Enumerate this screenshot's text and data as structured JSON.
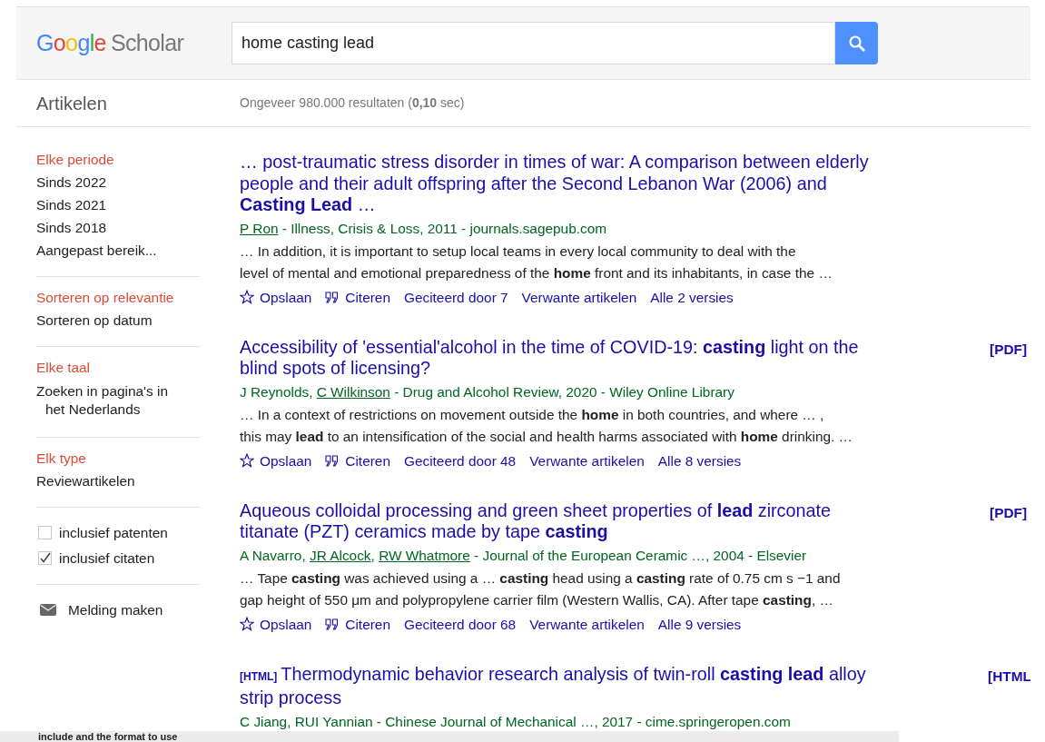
{
  "header": {
    "logo": "Google",
    "logo_suffix": "Scholar",
    "search": {
      "value": "home casting lead"
    }
  },
  "subheader": {
    "section": "Artikelen",
    "result_count": "Ongeveer 980.000 resultaten (**0,10** sec)"
  },
  "sidebar": {
    "groups": [
      {
        "items": [
          {
            "label": "Elke periode",
            "selected": true
          },
          {
            "label": "Sinds 2022",
            "selected": false
          },
          {
            "label": "Sinds 2021",
            "selected": false
          },
          {
            "label": "Sinds 2018",
            "selected": false
          },
          {
            "label": "Aangepast bereik...",
            "selected": false
          }
        ]
      },
      {
        "items": [
          {
            "label": "Sorteren op relevantie",
            "selected": true
          },
          {
            "label": "Sorteren op datum",
            "selected": false
          }
        ]
      },
      {
        "items": [
          {
            "label": "Elke taal",
            "selected": true
          },
          {
            "label": "Zoeken in pagina's in het Nederlands",
            "selected": false,
            "kind": "hanging"
          }
        ]
      },
      {
        "items": [
          {
            "label": "Elk type",
            "selected": true
          },
          {
            "label": "Reviewartikelen",
            "selected": false
          }
        ]
      }
    ],
    "options": [
      {
        "label": "inclusief patenten",
        "checked": false
      },
      {
        "label": "inclusief citaten",
        "checked": true
      }
    ],
    "alert": "Melding maken"
  },
  "results": [
    {
      "title": "… post-traumatic stress disorder in times of war: A comparison between elderly people and their adult offspring after the Second Lebanon War (2006) and **Casting Lead** …",
      "meta": [
        {
          "text": "P Ron",
          "linked": true
        },
        {
          "text": " - Illness, Crisis & Loss, 2011 - journals.sagepub.com",
          "linked": false
        }
      ],
      "snippet": [
        "… In addition, it is important to setup local teams in every local community to deal with the",
        "level of mental and emotional preparedness of the **home** front and its inhabitants, in case the …"
      ],
      "actions": [
        {
          "kind": "save",
          "label": "Opslaan"
        },
        {
          "kind": "cite",
          "label": "Citeren"
        },
        {
          "kind": "link",
          "label": "Geciteerd door 7"
        },
        {
          "kind": "link",
          "label": "Verwante artikelen"
        },
        {
          "kind": "link",
          "label": "Alle 2 versies"
        }
      ]
    },
    {
      "title": "Accessibility of 'essential'alcohol in the time of COVID-19: **casting** light on the blind spots of licensing?",
      "side_link": "[PDF]",
      "meta": [
        {
          "text": "J Reynolds, ",
          "linked": false
        },
        {
          "text": "C Wilkinson",
          "linked": true
        },
        {
          "text": " - Drug and Alcohol Review, 2020 - Wiley Online Library",
          "linked": false
        }
      ],
      "snippet": [
        "… In a context of restrictions on movement outside the **home** in both countries, and where … ,",
        "this may **lead** to an intensification of the social and health harms associated with **home** drinking. …"
      ],
      "actions": [
        {
          "kind": "save",
          "label": "Opslaan"
        },
        {
          "kind": "cite",
          "label": "Citeren"
        },
        {
          "kind": "link",
          "label": "Geciteerd door 48"
        },
        {
          "kind": "link",
          "label": "Verwante artikelen"
        },
        {
          "kind": "link",
          "label": "Alle 8 versies"
        }
      ]
    },
    {
      "title": "Aqueous colloidal processing and green sheet properties of **lead** zirconate titanate (PZT) ceramics made by tape **casting**",
      "side_link": "[PDF]",
      "meta": [
        {
          "text": "A Navarro, ",
          "linked": false
        },
        {
          "text": "JR Alcock",
          "linked": true
        },
        {
          "text": ", ",
          "linked": false
        },
        {
          "text": "RW Whatmore",
          "linked": true
        },
        {
          "text": " - Journal of the European Ceramic …, 2004 - Elsevier",
          "linked": false
        }
      ],
      "snippet": [
        "… Tape **casting** was achieved using a … **casting** head using a **casting** rate of 0.75 cm s −1 and",
        "gap height of 550 μm and polypropylene carrier film (Western Wallis, CA). After tape **casting**, …"
      ],
      "actions": [
        {
          "kind": "save",
          "label": "Opslaan"
        },
        {
          "kind": "cite",
          "label": "Citeren"
        },
        {
          "kind": "link",
          "label": "Geciteerd door 68"
        },
        {
          "kind": "link",
          "label": "Verwante artikelen"
        },
        {
          "kind": "link",
          "label": "Alle 9 versies"
        }
      ]
    },
    {
      "format": "[HTML]",
      "title": "Thermodynamic behavior research analysis of twin-roll **casting lead** alloy strip process",
      "side_link": "[HTML",
      "meta": [
        {
          "text": "C Jiang, RUI Yannian - Chinese Journal of Mechanical …, 2017 - cime.springeropen.com",
          "linked": false
        }
      ]
    }
  ],
  "overlay_strip": {
    "text": "include and the format to use"
  }
}
